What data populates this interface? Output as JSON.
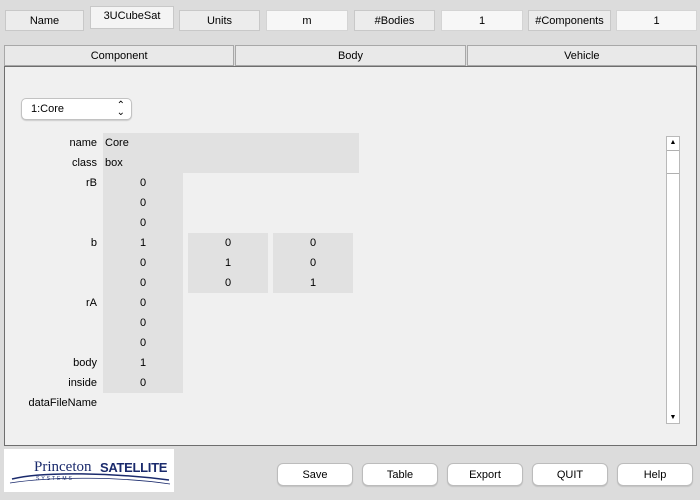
{
  "header": {
    "name_label": "Name",
    "name_value": "3UCubeSat",
    "units_label": "Units",
    "units_value": "m",
    "bodies_label": "#Bodies",
    "bodies_value": "1",
    "components_label": "#Components",
    "components_value": "1"
  },
  "tabs": [
    "Component",
    "Body",
    "Vehicle"
  ],
  "component_select": {
    "selected": "1:Core"
  },
  "fields": {
    "name": {
      "label": "name",
      "value": "Core"
    },
    "class": {
      "label": "class",
      "value": "box"
    },
    "rB": {
      "label": "rB",
      "values": [
        "0",
        "0",
        "0"
      ]
    },
    "b": {
      "label": "b",
      "matrix": [
        [
          "1",
          "0",
          "0"
        ],
        [
          "0",
          "1",
          "0"
        ],
        [
          "0",
          "0",
          "1"
        ]
      ]
    },
    "rA": {
      "label": "rA",
      "values": [
        "0",
        "0",
        "0"
      ]
    },
    "body": {
      "label": "body",
      "value": "1"
    },
    "inside": {
      "label": "inside",
      "value": "0"
    },
    "dataFileName": {
      "label": "dataFileName",
      "value": ""
    }
  },
  "logo": {
    "text_a": "Princeton",
    "text_b": "SATELLITE",
    "text_c": "SYSTEMS"
  },
  "buttons": {
    "save": "Save",
    "table": "Table",
    "export": "Export",
    "quit": "QUIT",
    "help": "Help"
  }
}
